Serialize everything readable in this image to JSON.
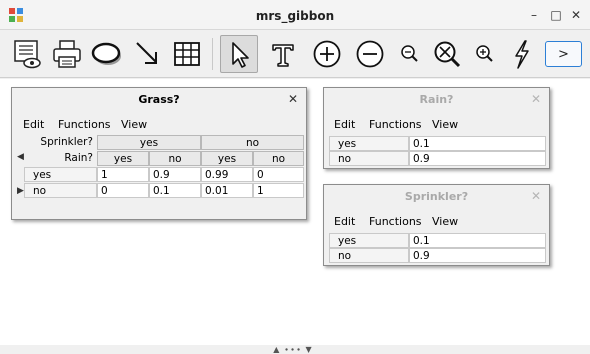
{
  "window": {
    "title": "mrs_gibbon",
    "minimize": "–",
    "maximize": "□",
    "close": "✕"
  },
  "toolbar": {
    "next_label": ">",
    "tools": [
      "view-document-icon",
      "print-icon",
      "ellipse-node-icon",
      "arrow-edge-icon",
      "table-icon",
      "select-pointer-icon",
      "text-icon",
      "zoom-plus-icon",
      "zoom-minus-icon",
      "zoom-out-icon",
      "zoom-fit-icon",
      "zoom-in-icon",
      "lightning-icon",
      "next-button"
    ]
  },
  "menus": {
    "edit": "Edit",
    "functions": "Functions",
    "view": "View"
  },
  "grass": {
    "title": "Grass?",
    "close": "✕",
    "parent1_label": "Sprinkler?",
    "parent2_label": "Rain?",
    "parent1_values": [
      "yes",
      "no"
    ],
    "parent2_values": [
      "yes",
      "no",
      "yes",
      "no"
    ],
    "rows": [
      {
        "state": "yes",
        "values": [
          "1",
          "0.9",
          "0.99",
          "0"
        ]
      },
      {
        "state": "no",
        "values": [
          "0",
          "0.1",
          "0.01",
          "1"
        ]
      }
    ]
  },
  "rain": {
    "title": "Rain?",
    "close": "✕",
    "rows": [
      {
        "state": "yes",
        "value": "0.1"
      },
      {
        "state": "no",
        "value": "0.9"
      }
    ]
  },
  "sprinkler": {
    "title": "Sprinkler?",
    "close": "✕",
    "rows": [
      {
        "state": "yes",
        "value": "0.1"
      },
      {
        "state": "no",
        "value": "0.9"
      }
    ]
  },
  "bottom": {
    "handle": "▲ ∙∙∙ ▼"
  }
}
